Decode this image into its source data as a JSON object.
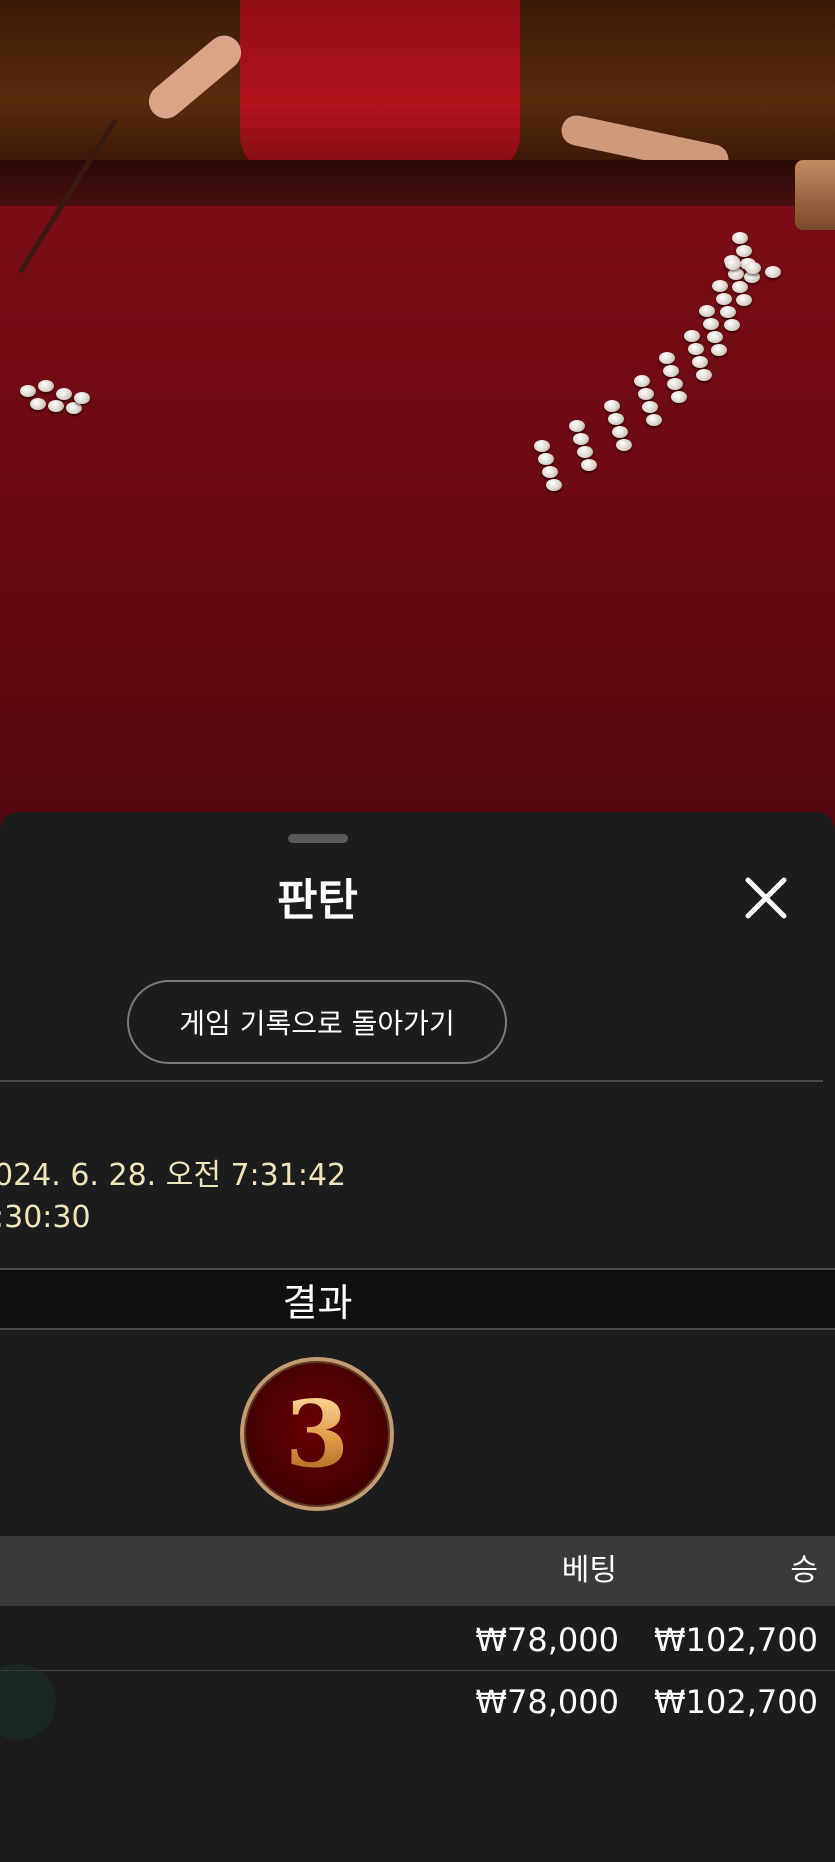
{
  "sheet": {
    "title": "판탄",
    "back_button": "게임 기록으로 돌아가기",
    "datetime": "024. 6. 28. 오전 7:31:42",
    "duration": ":30:30",
    "result_header": "결과",
    "result_value": "3",
    "table": {
      "headers": {
        "bet": "베팅",
        "win": "승"
      },
      "rows": [
        {
          "bet": "₩78,000",
          "win": "₩102,700"
        },
        {
          "bet": "₩78,000",
          "win": "₩102,700"
        }
      ]
    }
  },
  "colors": {
    "sheet_bg": "#1c1c1c",
    "accent_text": "#f1e4b8",
    "result_ball": "#4a0003",
    "result_ring": "#c49a72",
    "header_bg": "#3a3a3a"
  },
  "icons": {
    "close": "close-icon"
  }
}
